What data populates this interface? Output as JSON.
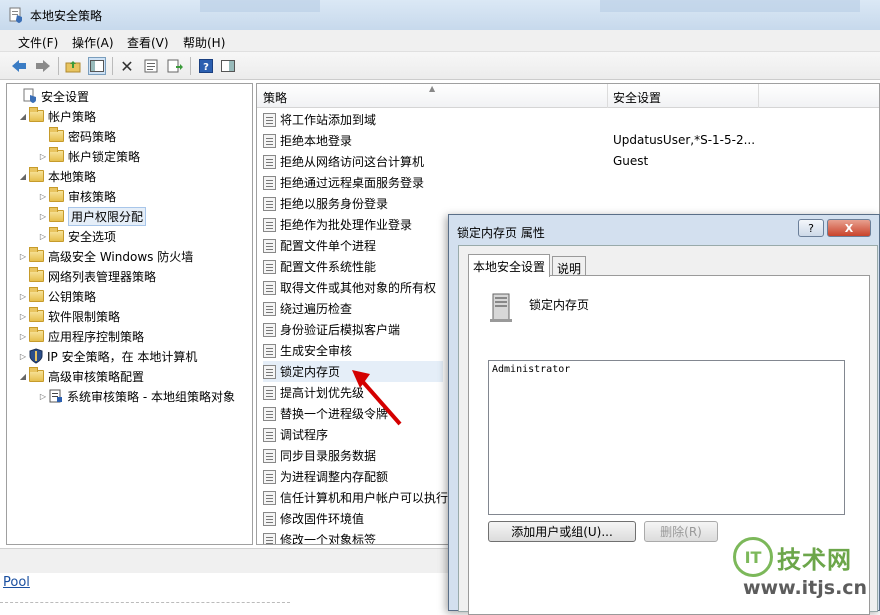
{
  "window": {
    "title": "本地安全策略",
    "title_icon": "security-policy-icon"
  },
  "menu": [
    "文件(F)",
    "操作(A)",
    "查看(V)",
    "帮助(H)"
  ],
  "toolbar_icons": [
    "back-arrow-icon",
    "forward-arrow-icon",
    "up-folder-icon",
    "show-tree-icon",
    "delete-icon",
    "properties-icon",
    "export-list-icon",
    "help-icon",
    "show-pane-icon"
  ],
  "tree": [
    {
      "label": "安全设置",
      "expander": "",
      "icon": "security-root"
    },
    {
      "label": "帐户策略",
      "expander": "◢",
      "icon": "folder"
    },
    {
      "label": "密码策略",
      "expander": "",
      "icon": "folder"
    },
    {
      "label": "帐户锁定策略",
      "expander": "▷",
      "icon": "folder"
    },
    {
      "label": "本地策略",
      "expander": "◢",
      "icon": "folder"
    },
    {
      "label": "审核策略",
      "expander": "▷",
      "icon": "folder"
    },
    {
      "label": "用户权限分配",
      "expander": "▷",
      "icon": "folder",
      "selected": true
    },
    {
      "label": "安全选项",
      "expander": "▷",
      "icon": "folder"
    },
    {
      "label": "高级安全 Windows 防火墙",
      "expander": "▷",
      "icon": "folder"
    },
    {
      "label": "网络列表管理器策略",
      "expander": "",
      "icon": "folder"
    },
    {
      "label": "公钥策略",
      "expander": "▷",
      "icon": "folder"
    },
    {
      "label": "软件限制策略",
      "expander": "▷",
      "icon": "folder"
    },
    {
      "label": "应用程序控制策略",
      "expander": "▷",
      "icon": "folder"
    },
    {
      "label": "IP 安全策略，在 本地计算机",
      "expander": "▷",
      "icon": "shield"
    },
    {
      "label": "高级审核策略配置",
      "expander": "◢",
      "icon": "folder"
    },
    {
      "label": "系统审核策略 - 本地组策略对象",
      "expander": "▷",
      "icon": "audit"
    }
  ],
  "list": {
    "col_policy": "策略",
    "col_setting": "安全设置",
    "rows": [
      {
        "policy": "将工作站添加到域",
        "setting": ""
      },
      {
        "policy": "拒绝本地登录",
        "setting": "UpdatusUser,*S-1-5-2..."
      },
      {
        "policy": "拒绝从网络访问这台计算机",
        "setting": "Guest"
      },
      {
        "policy": "拒绝通过远程桌面服务登录",
        "setting": ""
      },
      {
        "policy": "拒绝以服务身份登录",
        "setting": ""
      },
      {
        "policy": "拒绝作为批处理作业登录",
        "setting": ""
      },
      {
        "policy": "配置文件单个进程",
        "setting": ""
      },
      {
        "policy": "配置文件系统性能",
        "setting": ""
      },
      {
        "policy": "取得文件或其他对象的所有权",
        "setting": ""
      },
      {
        "policy": "绕过遍历检查",
        "setting": ""
      },
      {
        "policy": "身份验证后模拟客户端",
        "setting": ""
      },
      {
        "policy": "生成安全审核",
        "setting": ""
      },
      {
        "policy": "锁定内存页",
        "setting": "",
        "selected": true
      },
      {
        "policy": "提高计划优先级",
        "setting": ""
      },
      {
        "policy": "替换一个进程级令牌",
        "setting": ""
      },
      {
        "policy": "调试程序",
        "setting": ""
      },
      {
        "policy": "同步目录服务数据",
        "setting": ""
      },
      {
        "policy": "为进程调整内存配额",
        "setting": ""
      },
      {
        "policy": "信任计算机和用户帐户可以执行",
        "setting": ""
      },
      {
        "policy": "修改固件环境值",
        "setting": ""
      },
      {
        "policy": "修改一个对象标签",
        "setting": ""
      }
    ]
  },
  "below": {
    "link": "Pool"
  },
  "dialog": {
    "title": "锁定内存页 属性",
    "help_btn": "?",
    "close_btn": "X",
    "tabs": [
      "本地安全设置",
      "说明"
    ],
    "policy_name": "锁定内存页",
    "users": [
      "Administrator"
    ],
    "add_button": "添加用户或组(U)...",
    "remove_button": "删除(R)"
  },
  "watermark": {
    "badge": "IT",
    "line1": "技术网",
    "line2": "www.itjs.cn"
  },
  "colors": {
    "annotation_red": "#d40000",
    "accent_blue": "#1a4fa0",
    "watermark_green": "#6ca64a"
  }
}
